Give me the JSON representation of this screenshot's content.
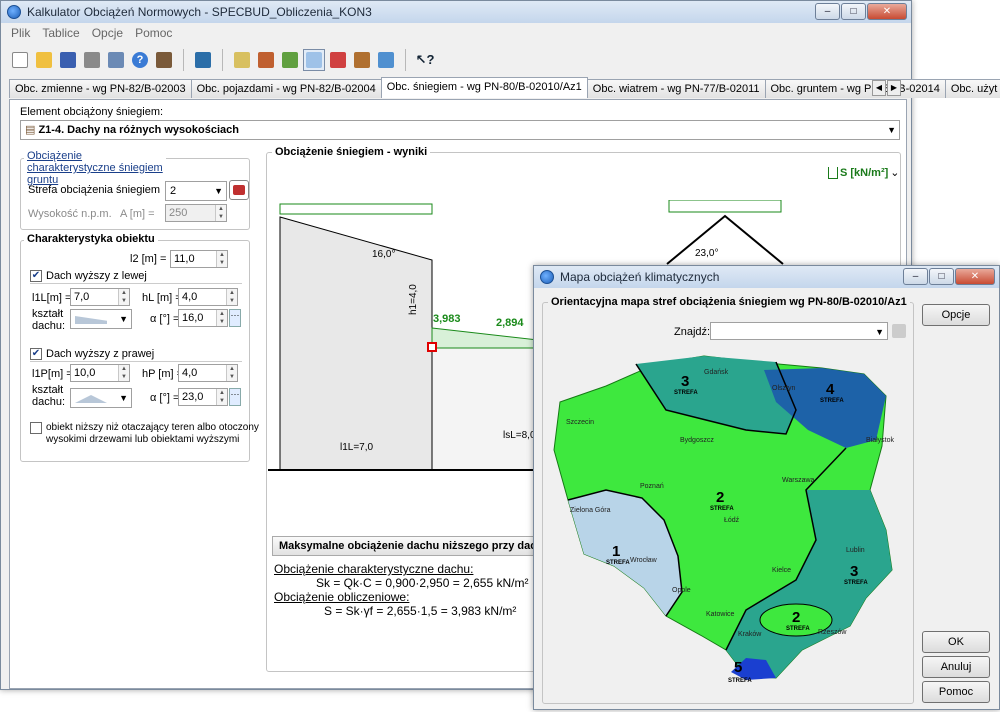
{
  "main": {
    "title": "Kalkulator Obciążeń Normowych - SPECBUD_Obliczenia_KON3",
    "menu": [
      "Plik",
      "Tablice",
      "Opcje",
      "Pomoc"
    ],
    "tabs": [
      "Obc. zmienne - wg PN-82/B-02003",
      "Obc. pojazdami - wg PN-82/B-02004",
      "Obc. śniegiem - wg PN-80/B-02010/Az1",
      "Obc. wiatrem - wg PN-77/B-02011",
      "Obc. gruntem - wg PN-88/B-02014",
      "Obc. użyt"
    ],
    "element_label": "Element obciążony śniegiem:",
    "element_value": "Z1-4. Dachy na różnych wysokościach",
    "snow_group_title": "Obciążenie charakterystyczne śniegiem gruntu",
    "zone_label": "Strefa obciążenia śniegiem",
    "zone_value": "2",
    "height_label": "Wysokość n.p.m.",
    "height_unit": "A [m] =",
    "height_value": "250",
    "object_group_title": "Charakterystyka obiektu",
    "l2_label": "l2 [m] =",
    "l2_value": "11,0",
    "left_roof_label": "Dach wyższy z lewej",
    "l1L_label": "l1L[m] =",
    "l1L_value": "7,0",
    "hL_label": "hL [m] =",
    "hL_value": "4,0",
    "shape_label_1": "kształt",
    "shape_label_2": "dachu:",
    "alpha_label": "α [°] =",
    "alphaL_value": "16,0",
    "right_roof_label": "Dach wyższy z prawej",
    "l1P_label": "l1P[m] =",
    "l1P_value": "10,0",
    "hP_label": "hP [m] =",
    "hP_value": "4,0",
    "alphaP_value": "23,0",
    "lower_obj_line1": "obiekt niższy niż otaczający teren albo otoczony",
    "lower_obj_line2": "wysokimi drzewami lub obiektami wyższymi",
    "results_title": "Obciążenie śniegiem - wyniki",
    "unit_label": "S [kN/m²]",
    "dims": {
      "a1": "16,0°",
      "a2": "23,0°",
      "h1": "h1=4,0",
      "v1": "3,983",
      "v2": "2,894",
      "l1L": "l1L=7,0",
      "lsL": "lsL=8,0"
    },
    "max_header": "Maksymalne obciążenie dachu niższego przy dachu",
    "char_label": "Obciążenie charakterystyczne dachu:",
    "char_formula": "Sk = Qk·C = 0,900·2,950 = 2,655 kN/m²",
    "calc_label": "Obciążenie obliczeniowe:",
    "calc_formula": "S = Sk·γf = 2,655·1,5 = 3,983 kN/m²"
  },
  "dialog": {
    "title": "Mapa obciążeń klimatycznych",
    "map_title": "Orientacyjna mapa stref obciążenia śniegiem wg PN-80/B-02010/Az1",
    "find_label": "Znajdź:",
    "options_btn": "Opcje",
    "ok_btn": "OK",
    "cancel_btn": "Anuluj",
    "help_btn": "Pomoc",
    "zone_word": "STREFA",
    "zones": [
      "3",
      "4",
      "2",
      "1",
      "3",
      "2",
      "5"
    ],
    "cities": [
      "Gdańsk",
      "Olsztyn",
      "Białystok",
      "Szczecin",
      "Bydgoszcz",
      "Poznań",
      "Warszawa",
      "Zielona Góra",
      "Łódź",
      "Lublin",
      "Wrocław",
      "Kielce",
      "Opole",
      "Katowice",
      "Kraków",
      "Rzeszów"
    ]
  },
  "colors": {
    "zone1": "#b8d4e8",
    "zone2": "#3ee83e",
    "zone3": "#2aa58e",
    "zone4": "#1d62a8",
    "zone5": "#1a3fd0",
    "accent": "#1a3f8a"
  }
}
